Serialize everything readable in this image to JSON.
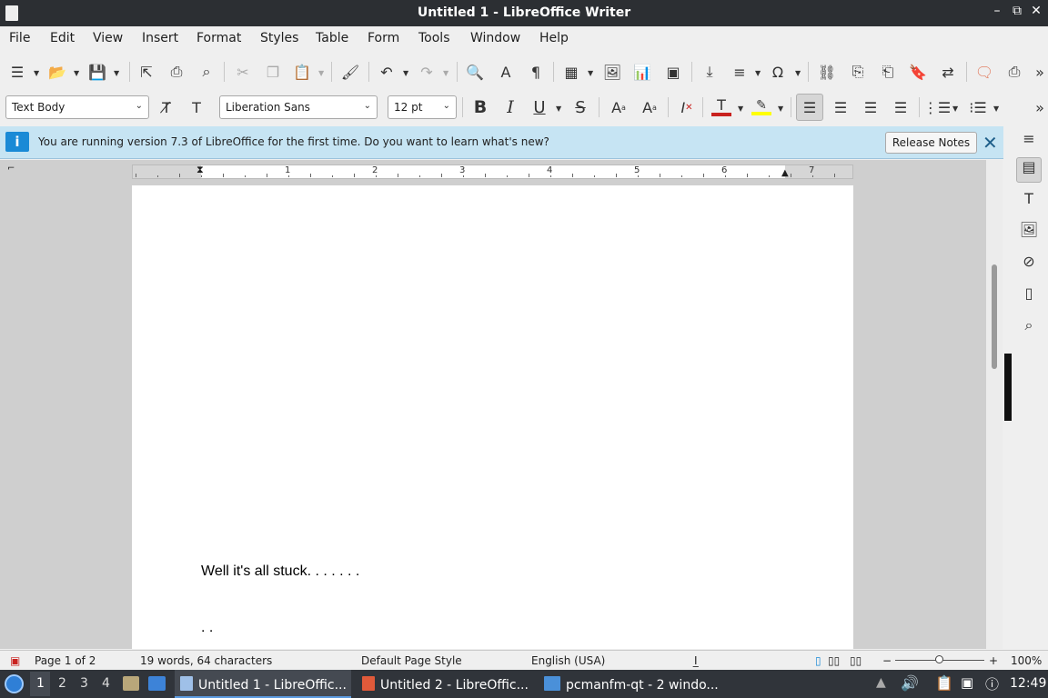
{
  "window": {
    "title": "Untitled 1 - LibreOffice Writer"
  },
  "menu": [
    "File",
    "Edit",
    "View",
    "Insert",
    "Format",
    "Styles",
    "Table",
    "Form",
    "Tools",
    "Window",
    "Help"
  ],
  "formatting": {
    "paragraph_style": "Text Body",
    "font_name": "Liberation Sans",
    "font_size": "12 pt"
  },
  "infobar": {
    "message": "You are running version 7.3 of LibreOffice for the first time. Do you want to learn what's new?",
    "button_label": "Release Notes"
  },
  "ruler": {
    "numbers": [
      "1",
      "2",
      "3",
      "4",
      "5",
      "6",
      "7"
    ]
  },
  "document": {
    "lines": [
      "Well it's all stuck. . . . . . .",
      ". ."
    ]
  },
  "status": {
    "page": "Page 1 of 2",
    "words": "19 words, 64 characters",
    "page_style": "Default Page Style",
    "language": "English (USA)",
    "zoom": "100%"
  },
  "taskbar": {
    "workspaces": [
      "1",
      "2",
      "3",
      "4"
    ],
    "tasks": [
      "Untitled 1 - LibreOffic...",
      "Untitled 2 - LibreOffic...",
      "pcmanfm-qt - 2 windo..."
    ],
    "clock": "12:49"
  },
  "colors": {
    "accent_blue": "#1a8ad6",
    "infobar_bg": "#c6e4f3",
    "font_color_red": "#c9211e",
    "highlight_yellow": "#ffff00"
  }
}
